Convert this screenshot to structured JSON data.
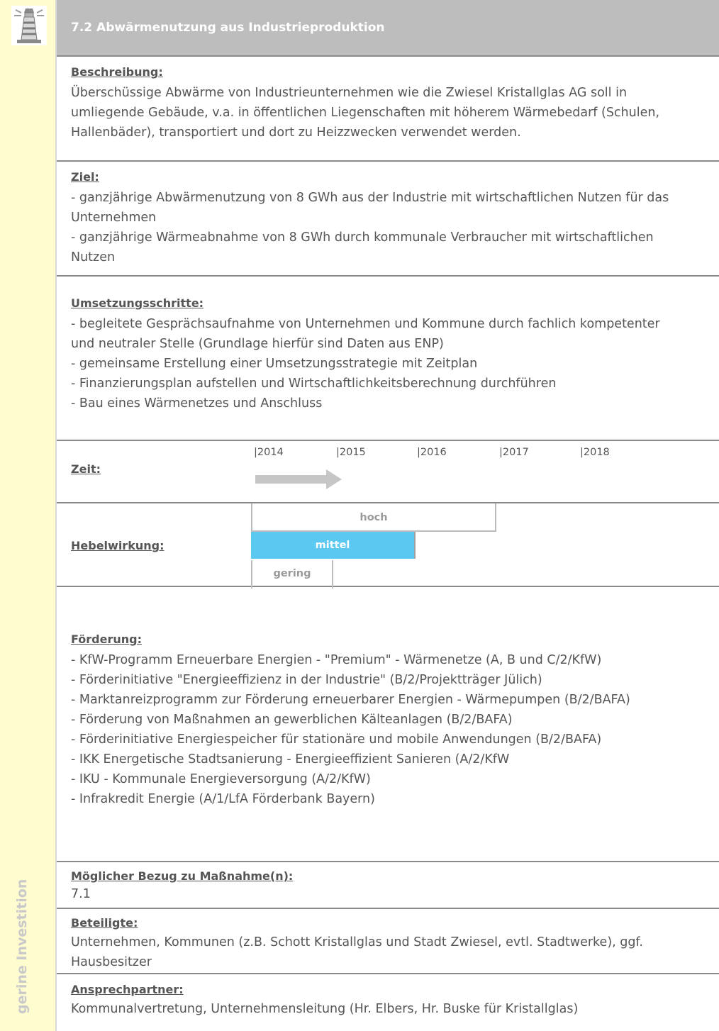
{
  "header": {
    "title": "7.2 Abwärmenutzung aus Industrieproduktion"
  },
  "sidebar": {
    "vertical_text": "gerine Investition",
    "icon": "lighthouse-icon"
  },
  "beschreibung": {
    "heading": "Beschreibung:",
    "lines": [
      "Überschüssige Abwärme von Industrieunternehmen wie die Zwiesel Kristallglas AG soll in",
      "umliegende Gebäude, v.a. in öffentlichen Liegenschaften mit höherem Wärmebedarf (Schulen,",
      "Hallenbäder), transportiert und dort zu Heizzwecken verwendet werden."
    ]
  },
  "ziel": {
    "heading": "Ziel:",
    "lines": [
      "- ganzjährige Abwärmenutzung von 8 GWh aus der Industrie mit wirtschaftlichen Nutzen für das",
      "Unternehmen",
      "- ganzjährige Wärmeabnahme von 8 GWh durch kommunale Verbraucher mit wirtschaftlichen",
      "Nutzen"
    ]
  },
  "umsetzung": {
    "heading": "Umsetzungsschritte:",
    "lines": [
      "- begleitete Gesprächsaufnahme von Unternehmen und Kommune durch fachlich  kompetenter",
      "und neutraler Stelle (Grundlage hierfür sind Daten aus ENP)",
      "- gemeinsame Erstellung einer Umsetzungsstrategie mit Zeitplan",
      "- Finanzierungsplan aufstellen und Wirtschaftlichkeitsberechnung durchführen",
      "- Bau eines Wärmenetzes und Anschluss"
    ]
  },
  "zeit": {
    "heading": "Zeit:",
    "years": [
      "|2014",
      "|2015",
      "|2016",
      "|2017",
      "|2018"
    ],
    "arrow_from": "2014",
    "arrow_to": "2015"
  },
  "hebel": {
    "heading": "Hebelwirkung:",
    "levels": [
      "hoch",
      "mittel",
      "gering"
    ],
    "selected": "mittel",
    "accent_color": "#5bc8f2"
  },
  "foerderung": {
    "heading": "Förderung:",
    "lines": [
      "- KfW-Programm Erneuerbare Energien - \"Premium\" - Wärmenetze  (A, B und C/2/KfW)",
      "- Förderinitiative \"Energieeffizienz in der Industrie\" (B/2/Projektträger Jülich)",
      "- Marktanreizprogramm zur Förderung erneuerbarer Energien - Wärmepumpen (B/2/BAFA)",
      "- Förderung von Maßnahmen an gewerblichen Kälteanlagen (B/2/BAFA)",
      "- Förderinitiative Energiespeicher für stationäre und mobile Anwendungen (B/2/BAFA)",
      "- IKK Energetische Stadtsanierung - Energieeffizient Sanieren (A/2/KfW",
      "- IKU - Kommunale Energieversorgung (A/2/KfW)",
      "- Infrakredit Energie (A/1/LfA Förderbank Bayern)"
    ]
  },
  "bezug": {
    "heading": "Möglicher Bezug zu Maßnahme(n):",
    "value": "7.1"
  },
  "beteiligte": {
    "heading": "Beteiligte:",
    "lines": [
      "Unternehmen, Kommunen (z.B. Schott Kristallglas und Stadt Zwiesel, evtl. Stadtwerke), ggf.",
      "Hausbesitzer"
    ]
  },
  "ansprech": {
    "heading": "Ansprechpartner:",
    "value": "Kommunalvertretung, Unternehmensleitung (Hr. Elbers, Hr. Buske für Kristallglas)"
  }
}
